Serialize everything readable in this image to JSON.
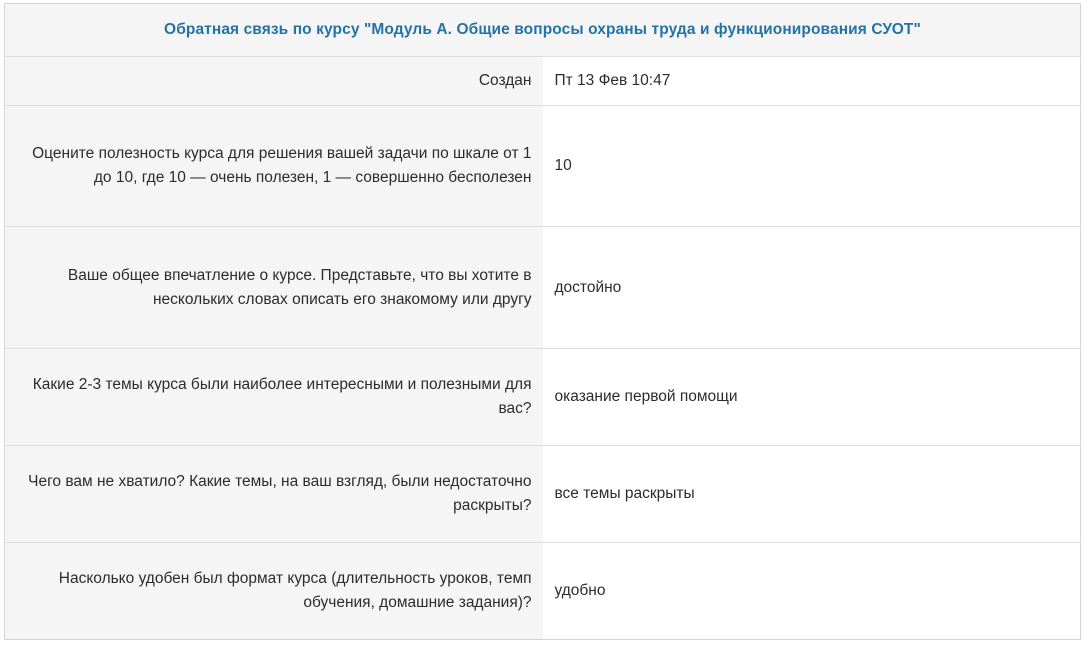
{
  "feedback": {
    "title": "Обратная связь по курсу \"Модуль А. Общие вопросы охраны труда и функционирования СУОТ\"",
    "created_label": "Создан",
    "created_value": "Пт 13 Фев 10:47",
    "questions": [
      {
        "label": "Оцените полезность курса для решения вашей задачи по шкале от 1 до 10, где 10 — очень полезен, 1 — совершенно бесполезен",
        "answer": "10"
      },
      {
        "label": "Ваше общее впечатление о курсе. Представьте, что вы хотите в нескольких словах описать его знакомому или другу",
        "answer": "достойно"
      },
      {
        "label": "Какие 2-3 темы курса были наиболее интересными и полезными для вас?",
        "answer": "оказание первой помощи"
      },
      {
        "label": "Чего вам не хватило? Какие темы, на ваш взгляд, были недостаточно раскрыты?",
        "answer": "все темы раскрыты"
      },
      {
        "label": "Насколько удобен был формат курса (длительность уроков, темп обучения, домашние задания)?",
        "answer": "удобно"
      }
    ]
  }
}
